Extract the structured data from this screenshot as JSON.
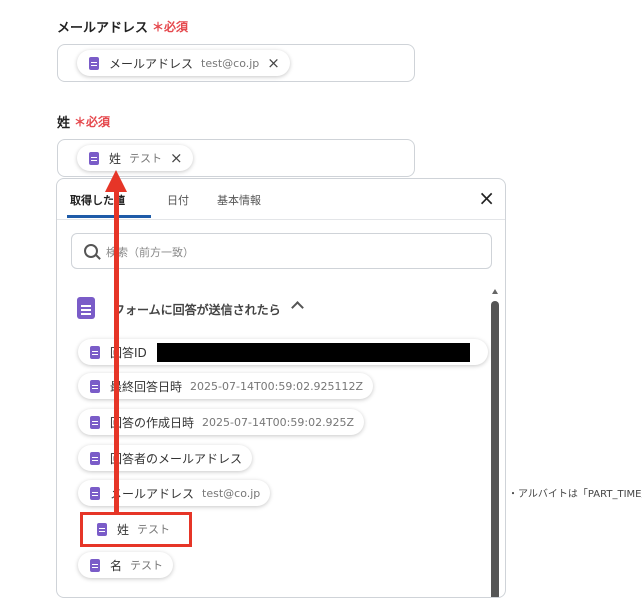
{
  "email_field": {
    "label": "メールアドレス",
    "required": "＊必須",
    "chip_name": "メールアドレス",
    "chip_value": "test@co.jp",
    "remove": "×"
  },
  "lastname_field": {
    "label": "姓",
    "required": "＊必須",
    "chip_name": "姓",
    "chip_value": "テスト",
    "remove": "×"
  },
  "panel": {
    "tabs": [
      {
        "label": "取得した値"
      },
      {
        "label": "日付"
      },
      {
        "label": "基本情報"
      }
    ],
    "close": "×",
    "search_placeholder": "検索（前方一致）",
    "group_title": "フォームに回答が送信されたら",
    "items": [
      {
        "name": "回答ID",
        "value": ""
      },
      {
        "name": "最終回答日時",
        "value": "2025-07-14T00:59:02.925112Z"
      },
      {
        "name": "回答の作成日時",
        "value": "2025-07-14T00:59:02.925Z"
      },
      {
        "name": "回答者のメールアドレス",
        "value": ""
      },
      {
        "name": "メールアドレス",
        "value": "test@co.jp"
      },
      {
        "name": "姓",
        "value": "テスト"
      },
      {
        "name": "名",
        "value": "テスト"
      }
    ]
  },
  "side_note": "・アルバイトは「PART_TIME」と",
  "colors": {
    "accent_red": "#e63527",
    "required_red": "#e5484d",
    "form_purple": "#7a5cc8",
    "tab_underline": "#1e5ba8"
  }
}
